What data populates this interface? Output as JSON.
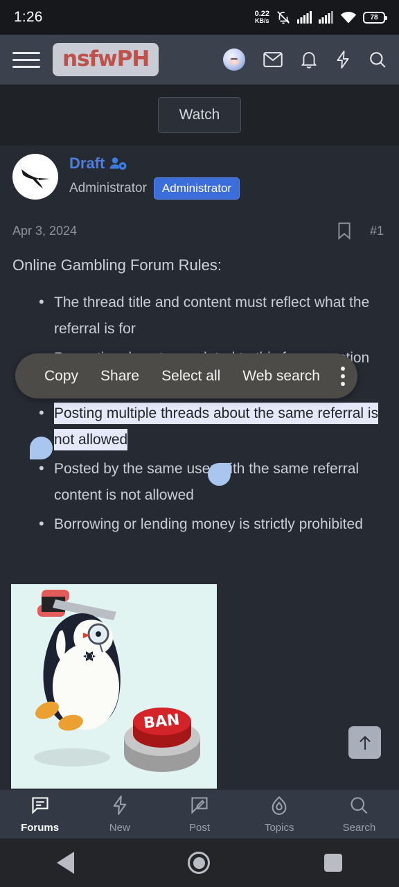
{
  "status_bar": {
    "time": "1:26",
    "net_speed_value": "0.22",
    "net_speed_unit": "KB/s",
    "icons": [
      "mute-bell-icon",
      "signal-sim1-icon",
      "signal-sim2-icon",
      "wifi-icon"
    ],
    "battery_percent": "78"
  },
  "header": {
    "menu_icon": "hamburger-menu-icon",
    "logo_text": "nsfwPH",
    "logo_color": "#c0504a",
    "icons": [
      "avatar-icon",
      "mail-icon",
      "bell-icon",
      "lightning-icon",
      "search-icon"
    ]
  },
  "thread": {
    "watch_label": "Watch"
  },
  "post": {
    "author_name": "Draft",
    "author_title": "Administrator",
    "author_badge": "Administrator",
    "badge_color": "#3b6ddb",
    "date": "Apr 3, 2024",
    "post_number": "#1",
    "bookmark_icon": "bookmark-icon",
    "heading": "Online Gambling Forum Rules:",
    "rules": [
      {
        "text": "The thread title and content must reflect what the referral is for",
        "selected": false
      },
      {
        "text": "Promotional posts unrelated to this forum section aren't allowed",
        "selected": false
      },
      {
        "text": "Posting multiple threads about the same referral is not allowed",
        "selected": true
      },
      {
        "text": "Posted by the same user with the same referral content is not allowed",
        "selected": false
      },
      {
        "text": "Borrowing or lending money is strictly prohibited",
        "selected": false
      }
    ],
    "attachment_alt": "penguin-with-hammer-and-ban-button-image",
    "attachment_label": "BAN"
  },
  "selection_toolbar": {
    "items": [
      "Copy",
      "Share",
      "Select all",
      "Web search"
    ],
    "overflow_icon": "three-dot-overflow-icon"
  },
  "scroll_top": {
    "icon": "arrow-up-icon"
  },
  "bottom_nav": {
    "items": [
      {
        "label": "Forums",
        "icon": "forums-icon",
        "active": true
      },
      {
        "label": "New",
        "icon": "lightning-icon",
        "active": false
      },
      {
        "label": "Post",
        "icon": "pencil-post-icon",
        "active": false
      },
      {
        "label": "Topics",
        "icon": "flame-icon",
        "active": false
      },
      {
        "label": "Search",
        "icon": "search-icon",
        "active": false
      }
    ]
  },
  "android_nav": {
    "back": "back-triangle-icon",
    "home": "home-circle-icon",
    "recents": "recents-square-icon"
  }
}
